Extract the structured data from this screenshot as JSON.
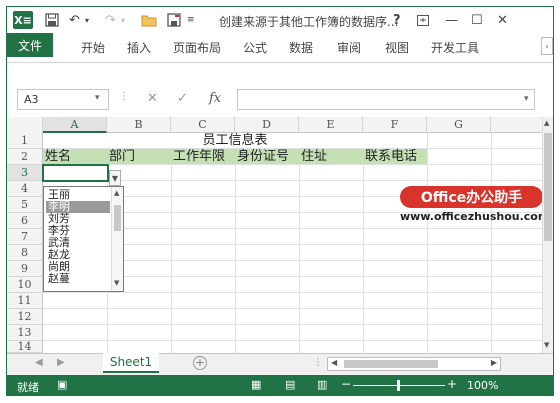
{
  "titlebar": {
    "title": "创建来源于其他工作簿的数据序...",
    "logo_text": "X≡",
    "help": "?",
    "window_controls": [
      "restore-icon",
      "minimize-icon",
      "maximize-icon",
      "close-icon"
    ]
  },
  "ribbon": {
    "file_tab": "文件",
    "tabs": [
      "开始",
      "插入",
      "页面布局",
      "公式",
      "数据",
      "审阅",
      "视图",
      "开发工具"
    ]
  },
  "formula_bar": {
    "cell_ref": "A3",
    "cancel": "✕",
    "confirm": "✓",
    "fx": "fx",
    "value": ""
  },
  "grid": {
    "columns": [
      "A",
      "B",
      "C",
      "D",
      "E",
      "F",
      "G"
    ],
    "rows": [
      "1",
      "2",
      "3",
      "4",
      "5",
      "6",
      "7",
      "8",
      "9",
      "10",
      "11",
      "12",
      "13",
      "14"
    ],
    "title": "员工信息表",
    "headers": [
      "姓名",
      "部门",
      "工作年限",
      "身份证号",
      "住址",
      "联系电话"
    ],
    "header_color": "#c4e0b4"
  },
  "dropdown": {
    "items": [
      "王丽",
      "李明",
      "刘芳",
      "李芬",
      "武清",
      "赵龙",
      "尚朗",
      "赵蔓"
    ],
    "selected_index": 1
  },
  "watermark": {
    "brand": "Office办公助手",
    "url": "www.officezhushou.com"
  },
  "sheets": {
    "active": "Sheet1"
  },
  "status": {
    "ready": "就绪",
    "zoom": "100%"
  },
  "colors": {
    "accent": "#217346",
    "watermark_red": "#d9342b"
  }
}
